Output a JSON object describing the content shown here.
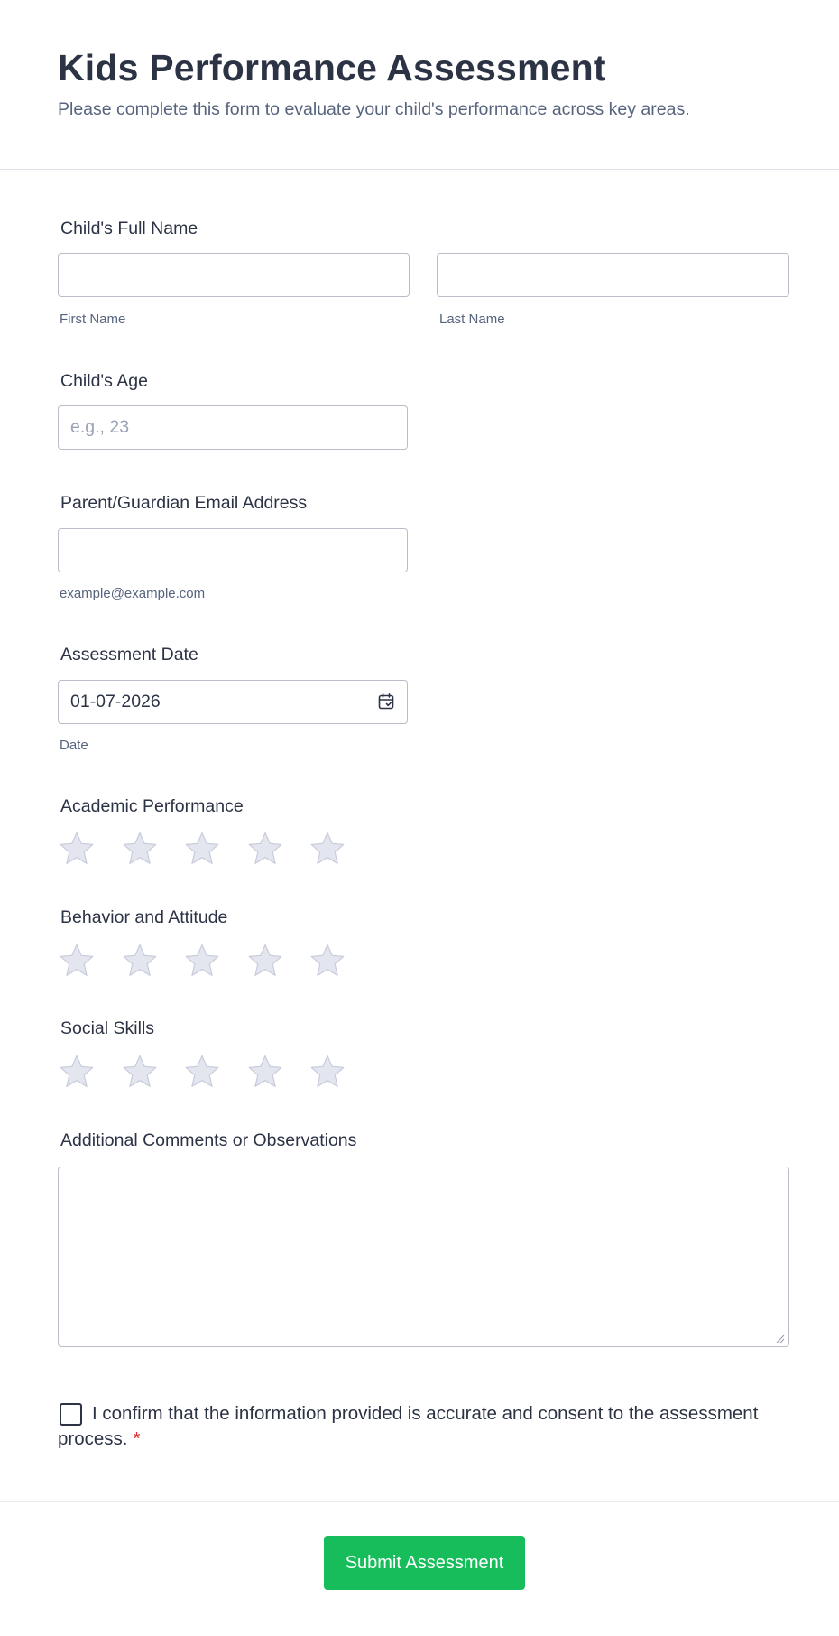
{
  "header": {
    "title": "Kids Performance Assessment",
    "subtitle": "Please complete this form to evaluate your child's performance across key areas."
  },
  "full_name": {
    "label": "Child's Full Name",
    "first_sublabel": "First Name",
    "last_sublabel": "Last Name",
    "first_value": "",
    "last_value": ""
  },
  "age": {
    "label": "Child's Age",
    "placeholder": "e.g., 23",
    "value": ""
  },
  "email": {
    "label": "Parent/Guardian Email Address",
    "sublabel": "example@example.com",
    "value": ""
  },
  "assessment_date": {
    "label": "Assessment Date",
    "value": "01-07-2026",
    "sublabel": "Date",
    "icon": "calendar-icon"
  },
  "ratings": [
    {
      "label": "Academic Performance",
      "max": 5,
      "value": 0
    },
    {
      "label": "Behavior and Attitude",
      "max": 5,
      "value": 0
    },
    {
      "label": "Social Skills",
      "max": 5,
      "value": 0
    }
  ],
  "comments": {
    "label": "Additional Comments or Observations",
    "value": ""
  },
  "consent": {
    "text": "I confirm that the information provided is accurate and consent to the assessment process.",
    "required_mark": "*",
    "checked": false
  },
  "submit_label": "Submit Assessment",
  "colors": {
    "accent_green": "#18bd5b",
    "required_red": "#e02e2e",
    "star_empty_fill": "#e3e5ef",
    "star_empty_stroke": "#c9ccdb",
    "text_dark": "#2c3345",
    "text_muted": "#57647e"
  }
}
